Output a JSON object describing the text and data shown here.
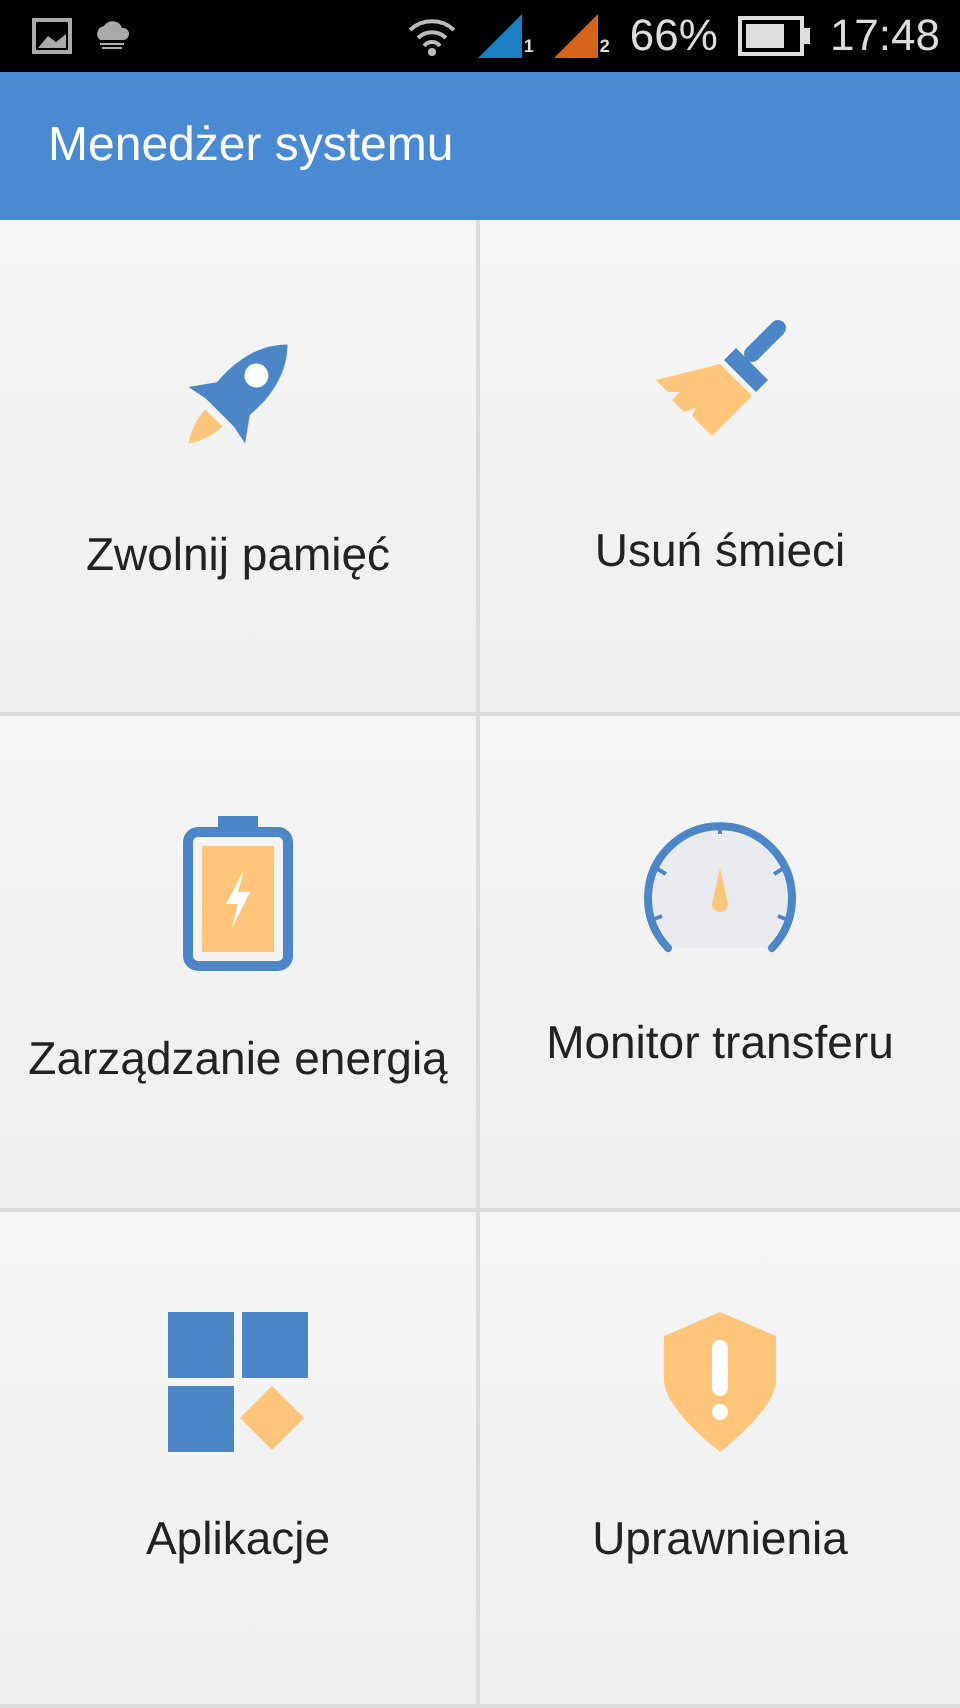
{
  "status_bar": {
    "sim_1": "1",
    "sim_2": "2",
    "battery_percent": "66%",
    "time": "17:48"
  },
  "header": {
    "title": "Menedżer systemu"
  },
  "tiles": [
    {
      "kind": "rocket",
      "label": "Zwolnij pamięć"
    },
    {
      "kind": "broom",
      "label": "Usuń śmieci"
    },
    {
      "kind": "battery",
      "label": "Zarządzanie energią"
    },
    {
      "kind": "gauge",
      "label": "Monitor transferu"
    },
    {
      "kind": "apps",
      "label": "Aplikacje"
    },
    {
      "kind": "shield",
      "label": "Uprawnienia"
    }
  ]
}
